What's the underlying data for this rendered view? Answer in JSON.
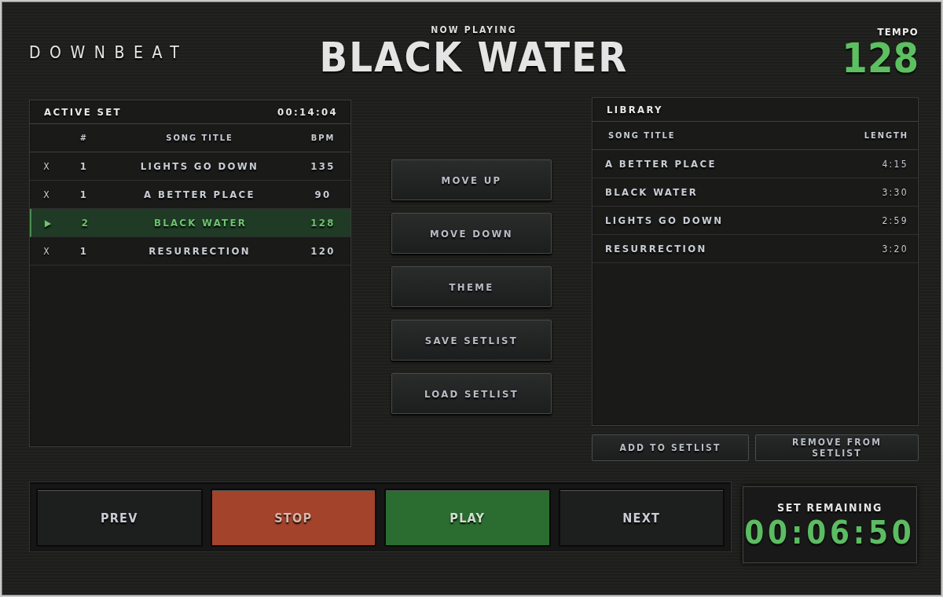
{
  "app": {
    "logo": "DOWNBEAT"
  },
  "now_playing": {
    "label": "NOW PLAYING",
    "title": "BLACK WATER"
  },
  "tempo": {
    "label": "TEMPO",
    "value": "128"
  },
  "active_set": {
    "title": "ACTIVE SET",
    "duration": "00:14:04",
    "columns": [
      "#",
      "SONG TITLE",
      "BPM"
    ],
    "rows": [
      {
        "marker": "X",
        "number": "1",
        "title": "LIGHTS GO DOWN",
        "bpm": "135",
        "selected": false
      },
      {
        "marker": "X",
        "number": "1",
        "title": "A BETTER PLACE",
        "bpm": "90",
        "selected": false
      },
      {
        "marker": "▶",
        "number": "2",
        "title": "BLACK WATER",
        "bpm": "128",
        "selected": true
      },
      {
        "marker": "X",
        "number": "1",
        "title": "RESURRECTION",
        "bpm": "120",
        "selected": false
      }
    ]
  },
  "actions": [
    "MOVE UP",
    "MOVE DOWN",
    "THEME",
    "SAVE SETLIST",
    "LOAD SETLIST"
  ],
  "library": {
    "title": "LIBRARY",
    "columns": [
      "SONG TITLE",
      "LENGTH"
    ],
    "rows": [
      {
        "title": "A BETTER PLACE",
        "length": "4:15"
      },
      {
        "title": "BLACK WATER",
        "length": "3:30"
      },
      {
        "title": "LIGHTS GO DOWN",
        "length": "2:59"
      },
      {
        "title": "RESURRECTION",
        "length": "3:20"
      }
    ],
    "buttons": [
      "ADD TO SETLIST",
      "REMOVE FROM SETLIST"
    ]
  },
  "transport": [
    {
      "label": "PREV",
      "kind": "default"
    },
    {
      "label": "STOP",
      "kind": "stop"
    },
    {
      "label": "PLAY",
      "kind": "play"
    },
    {
      "label": "NEXT",
      "kind": "default"
    }
  ],
  "set_remaining": {
    "label": "SET REMAINING",
    "time": "00:06:50"
  }
}
